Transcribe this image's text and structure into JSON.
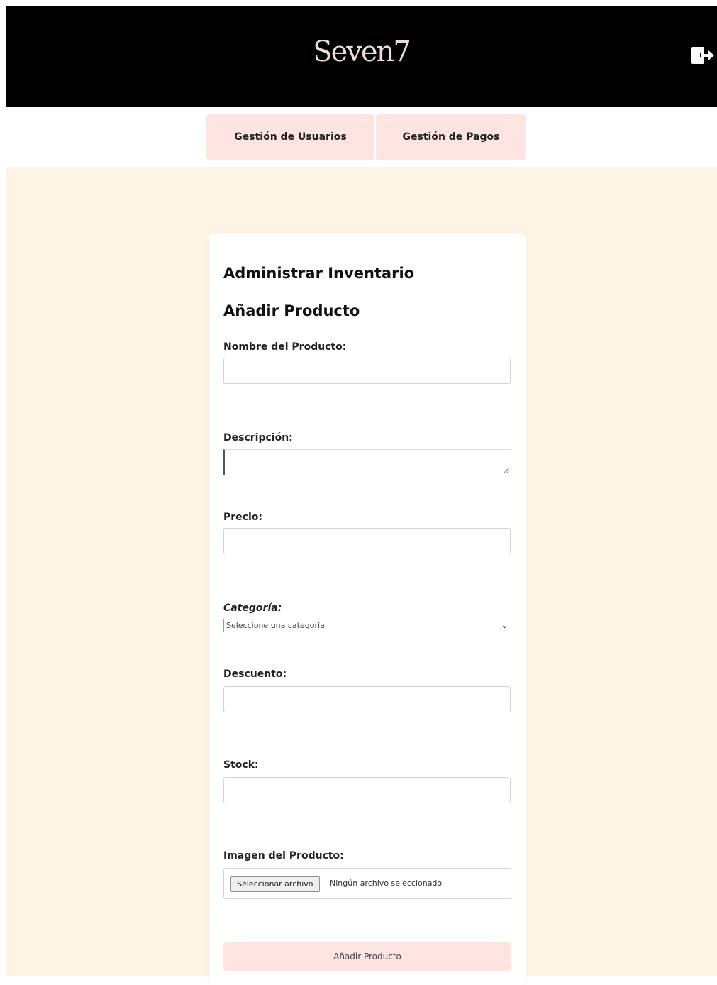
{
  "header": {
    "brand": "Seven7",
    "logout_icon": "logout-icon"
  },
  "nav": {
    "tabs": [
      {
        "label": "Gestión de Usuarios"
      },
      {
        "label": "Gestión de Pagos"
      }
    ]
  },
  "form": {
    "title": "Administrar Inventario",
    "subtitle": "Añadir Producto",
    "fields": {
      "nombre": {
        "label": "Nombre del Producto:",
        "value": ""
      },
      "descripcion": {
        "label": "Descripción:",
        "value": ""
      },
      "precio": {
        "label": "Precio:",
        "value": ""
      },
      "categoria": {
        "label": "Categoría:",
        "selected": "Seleccione una categoría"
      },
      "descuento": {
        "label": "Descuento:",
        "value": ""
      },
      "stock": {
        "label": "Stock:",
        "value": ""
      },
      "imagen": {
        "label": "Imagen del Producto:",
        "button": "Seleccionar archivo",
        "status": "Ningún archivo seleccionado"
      }
    },
    "submit_label": "Añadir Producto"
  },
  "colors": {
    "header_bg": "#000000",
    "tab_bg": "#fde4e1",
    "page_bg": "#fdf4e6",
    "card_bg": "#ffffff"
  }
}
